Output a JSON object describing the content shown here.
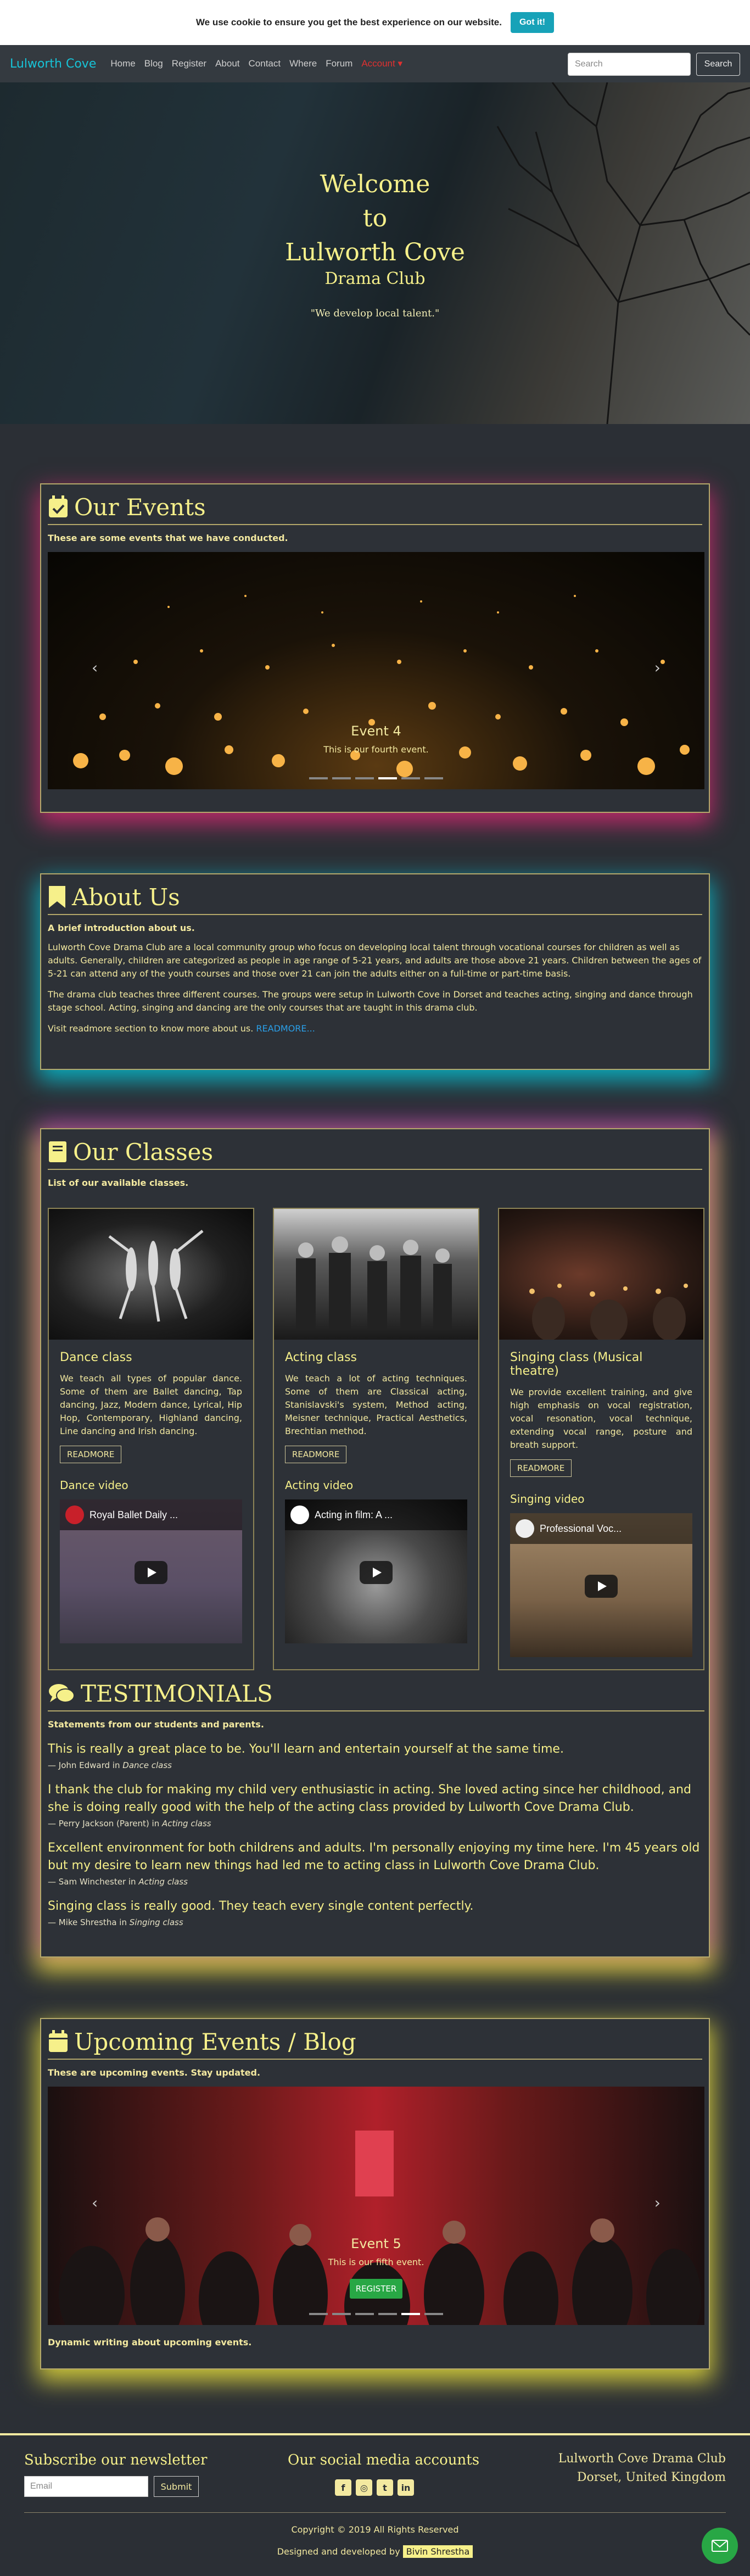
{
  "cookie": {
    "text": "We use cookie to ensure you get the best experience on our website.",
    "button": "Got it!"
  },
  "nav": {
    "brand": "Lulworth Cove",
    "items": [
      {
        "label": "Home"
      },
      {
        "label": "Blog"
      },
      {
        "label": "Register"
      },
      {
        "label": "About"
      },
      {
        "label": "Contact"
      },
      {
        "label": "Where"
      },
      {
        "label": "Forum"
      },
      {
        "label": "Account ▾"
      }
    ],
    "search_placeholder": "Search",
    "search_button": "Search"
  },
  "hero": {
    "line1": "Welcome",
    "line2": "to",
    "line3": "Lulworth Cove",
    "sub": "Drama Club",
    "quote": "\"We develop local talent.\""
  },
  "events": {
    "title": "Our Events",
    "lead": "These are some events that we have conducted.",
    "slide_title": "Event 4",
    "slide_text": "This is our fourth event."
  },
  "about": {
    "title": "About Us",
    "lead": "A brief introduction about us.",
    "p1": "Lulworth Cove Drama Club are a local community group who focus on developing local talent through vocational courses for children as well as adults. Generally, children are categorized as people in age range of 5-21 years, and adults are those above 21 years. Children between the ages of 5-21 can attend any of the youth courses and those over 21 can join the adults either on a full-time or part-time basis.",
    "p2": "The drama club teaches three different courses. The groups were setup in Lulworth Cove in Dorset and teaches acting, singing and dance through stage school. Acting, singing and dancing are the only courses that are taught in this drama club.",
    "p3": "Visit readmore section to know more about us.",
    "readmore": "READMORE..."
  },
  "classes": {
    "title": "Our Classes",
    "lead": "List of our available classes.",
    "cards": [
      {
        "title": "Dance class",
        "desc": "We teach all types of popular dance. Some of them are Ballet dancing, Tap dancing, Jazz, Modern dance, Lyrical, Hip Hop, Contemporary, Highland dancing, Line dancing and Irish dancing.",
        "readmore": "READMORE",
        "video_title": "Dance video",
        "video_label": "Royal Ballet Daily ..."
      },
      {
        "title": "Acting class",
        "desc": "We teach a lot of acting techniques. Some of them are Classical acting, Stanislavski's system, Method acting, Meisner technique, Practical Aesthetics, Brechtian method.",
        "readmore": "READMORE",
        "video_title": "Acting video",
        "video_label": "Acting in film: A ..."
      },
      {
        "title": "Singing class (Musical theatre)",
        "desc": "We provide excellent training, and give high emphasis on vocal registration, vocal resonation, vocal technique, extending vocal range, posture and breath support.",
        "readmore": "READMORE",
        "video_title": "Singing video",
        "video_label": "Professional Voc..."
      }
    ]
  },
  "testimonials": {
    "title": "TESTIMONIALS",
    "lead": "Statements from our students and parents.",
    "items": [
      {
        "quote": "This is really a great place to be. You'll learn and entertain yourself at the same time.",
        "author": "— John Edward in",
        "class": "Dance class"
      },
      {
        "quote": "I thank the club for making my child very enthusiastic in acting. She loved acting since her childhood, and she is doing really good with the help of the acting class provided by Lulworth Cove Drama Club.",
        "author": "— Perry Jackson (Parent) in",
        "class": "Acting class"
      },
      {
        "quote": "Excellent environment for both childrens and adults. I'm personally enjoying my time here. I'm 45 years old but my desire to learn new things had led me to acting class in Lulworth Cove Drama Club.",
        "author": "— Sam Winchester in",
        "class": "Acting class"
      },
      {
        "quote": "Singing class is really good. They teach every single content perfectly.",
        "author": "— Mike Shrestha in",
        "class": "Singing class"
      }
    ]
  },
  "upcoming": {
    "title": "Upcoming Events / Blog",
    "lead": "These are upcoming events. Stay updated.",
    "slide_title": "Event 5",
    "slide_text": "This is our fifth event.",
    "register": "REGISTER",
    "foot": "Dynamic writing about upcoming events."
  },
  "footer": {
    "newsletter_title": "Subscribe our newsletter",
    "email_placeholder": "Email",
    "submit": "Submit",
    "social_title": "Our social media accounts",
    "social_icons": [
      "facebook-icon",
      "instagram-icon",
      "twitter-icon",
      "linkedin-icon"
    ],
    "club_name": "Lulworth Cove Drama Club",
    "club_location": "Dorset, United Kingdom",
    "copyright": "Copyright © 2019 All Rights Reserved",
    "designed_by": "Designed and developed by",
    "developer": "Bivin Shrestha"
  },
  "colors": {
    "accent": "#f6f08a",
    "brand": "#17c4d8",
    "cookie_button": "#17a2b8",
    "register_button": "#28a745"
  }
}
